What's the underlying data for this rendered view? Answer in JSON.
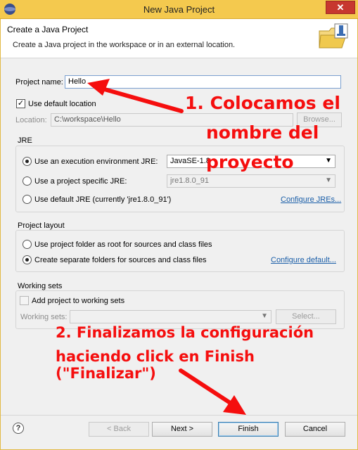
{
  "window": {
    "title": "New Java Project",
    "close_label": "✕"
  },
  "header": {
    "title": "Create a Java Project",
    "description": "Create a Java project in the workspace or in an external location."
  },
  "project": {
    "name_label": "Project name:",
    "name_value": "Hello",
    "use_default_label": "Use default location",
    "use_default_checked": true,
    "location_label": "Location:",
    "location_value": "C:\\workspace\\Hello",
    "browse_label": "Browse..."
  },
  "jre": {
    "title": "JRE",
    "option_env_label": "Use an execution environment JRE:",
    "option_env_value": "JavaSE-1.8",
    "option_specific_label": "Use a project specific JRE:",
    "option_specific_value": "jre1.8.0_91",
    "option_default_label": "Use default JRE (currently 'jre1.8.0_91')",
    "configure_link": "Configure JREs...",
    "selected": "env"
  },
  "layout": {
    "title": "Project layout",
    "option_root_label": "Use project folder as root for sources and class files",
    "option_separate_label": "Create separate folders for sources and class files",
    "configure_link": "Configure default...",
    "selected": "separate"
  },
  "working_sets": {
    "title": "Working sets",
    "add_label": "Add project to working sets",
    "sets_label": "Working sets:",
    "select_label": "Select..."
  },
  "footer": {
    "help_label": "?",
    "back_label": "< Back",
    "next_label": "Next >",
    "finish_label": "Finish",
    "cancel_label": "Cancel"
  },
  "annotations": {
    "step1_line1": "1. Colocamos el",
    "step1_line2": "nombre del",
    "step1_line3": "proyecto",
    "step2_line1": "2. Finalizamos la configuración",
    "step2_line2": "haciendo click en Finish (\"Finalizar\")"
  },
  "colors": {
    "accent": "#f4c94e",
    "annotation": "#f50e0e",
    "link": "#1a5ea8",
    "close": "#c7372f"
  },
  "icons": [
    "app-icon",
    "close-icon",
    "folder-icon",
    "chevron-down-icon",
    "help-icon",
    "arrow-icon"
  ]
}
